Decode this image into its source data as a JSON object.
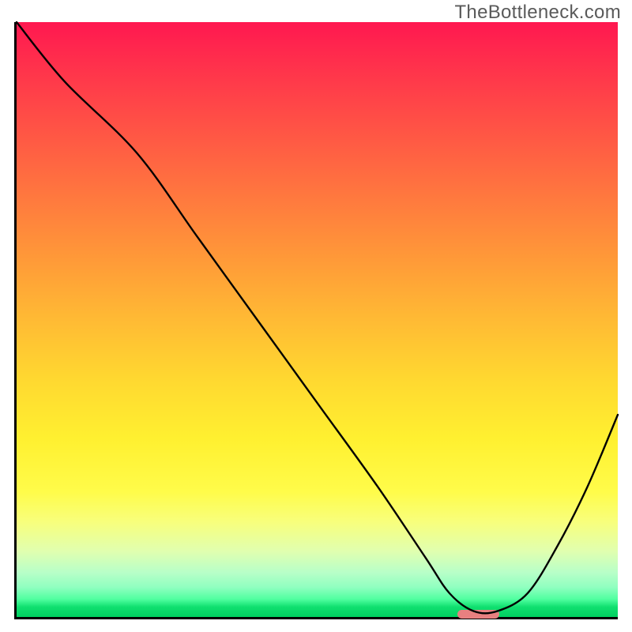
{
  "watermark": "TheBottleneck.com",
  "chart_data": {
    "type": "line",
    "title": "",
    "xlabel": "",
    "ylabel": "",
    "xlim": [
      0,
      100
    ],
    "ylim": [
      0,
      100
    ],
    "grid": false,
    "legend": false,
    "series": [
      {
        "name": "bottleneck-curve",
        "x": [
          0,
          8,
          20,
          30,
          40,
          50,
          60,
          68,
          72,
          76,
          80,
          85,
          90,
          95,
          100
        ],
        "values": [
          100,
          90,
          78,
          64,
          50,
          36,
          22,
          10,
          4,
          1,
          1,
          4,
          12,
          22,
          34
        ]
      }
    ],
    "annotations": [
      {
        "name": "optimal-marker",
        "x_start": 73,
        "x_end": 80,
        "y": 0
      }
    ],
    "background_gradient": {
      "direction": "vertical",
      "stops": [
        {
          "pct": 0,
          "color": "#ff1850"
        },
        {
          "pct": 50,
          "color": "#ffba34"
        },
        {
          "pct": 80,
          "color": "#fffc4a"
        },
        {
          "pct": 95,
          "color": "#90ffc0"
        },
        {
          "pct": 100,
          "color": "#00d060"
        }
      ]
    }
  }
}
